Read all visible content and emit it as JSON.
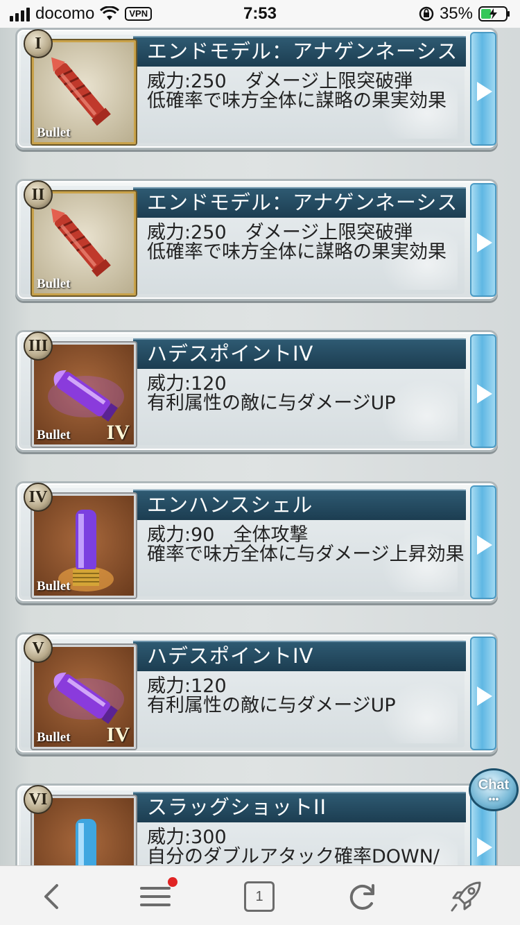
{
  "status_bar": {
    "carrier": "docomo",
    "vpn": "VPN",
    "time": "7:53",
    "battery_percent": "35%"
  },
  "list": {
    "items": [
      {
        "numeral": "I",
        "title": "エンドモデル：アナゲンネーシス",
        "lines": [
          "威力:250　ダメージ上限突破弾",
          "低確率で味方全体に謀略の果実効果"
        ],
        "bullet_label": "Bullet",
        "rank_label": "",
        "art": "red-bullet",
        "frame": "gold"
      },
      {
        "numeral": "II",
        "title": "エンドモデル：アナゲンネーシス",
        "lines": [
          "威力:250　ダメージ上限突破弾",
          "低確率で味方全体に謀略の果実効果"
        ],
        "bullet_label": "Bullet",
        "rank_label": "",
        "art": "red-bullet",
        "frame": "gold"
      },
      {
        "numeral": "III",
        "title": "ハデスポイントIV",
        "lines": [
          "威力:120",
          "有利属性の敵に与ダメージUP"
        ],
        "bullet_label": "Bullet",
        "rank_label": "IV",
        "art": "purple-bullet",
        "frame": "silver"
      },
      {
        "numeral": "IV",
        "title": "エンハンスシェル",
        "lines": [
          "威力:90　全体攻撃",
          "確率で味方全体に与ダメージ上昇効果"
        ],
        "bullet_label": "Bullet",
        "rank_label": "",
        "art": "purple-shell",
        "frame": "silver"
      },
      {
        "numeral": "V",
        "title": "ハデスポイントIV",
        "lines": [
          "威力:120",
          "有利属性の敵に与ダメージUP"
        ],
        "bullet_label": "Bullet",
        "rank_label": "IV",
        "art": "purple-bullet",
        "frame": "silver"
      },
      {
        "numeral": "VI",
        "title": "スラッグショットII",
        "lines": [
          "威力:300",
          "自分のダブルアタック確率DOWN/"
        ],
        "bullet_label": "",
        "rank_label": "",
        "art": "blue-shell",
        "frame": "silver"
      }
    ]
  },
  "chat_button": {
    "label": "Chat",
    "dots": "•••"
  },
  "toolbar": {
    "back_icon": "chevron-left-icon",
    "menu_icon": "menu-icon",
    "tab_count": "1",
    "reload_icon": "reload-icon",
    "rocket_icon": "rocket-icon"
  }
}
